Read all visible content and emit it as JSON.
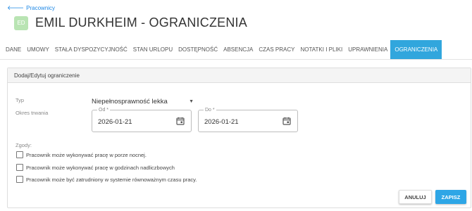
{
  "nav": {
    "back_arrow": "🡐",
    "back_label": "Pracownicy",
    "back_icon": "arrow-left-icon"
  },
  "header": {
    "avatar_initials": "ED",
    "title": "EMIL DURKHEIM - OGRANICZENIA"
  },
  "tabs": [
    {
      "label": "DANE",
      "active": false
    },
    {
      "label": "UMOWY",
      "active": false
    },
    {
      "label": "STAŁA DYSPOZYCYJNOŚĆ",
      "active": false
    },
    {
      "label": "STAN URLOPU",
      "active": false
    },
    {
      "label": "DOSTĘPNOŚĆ",
      "active": false
    },
    {
      "label": "ABSENCJA",
      "active": false
    },
    {
      "label": "CZAS PRACY",
      "active": false
    },
    {
      "label": "NOTATKI I PLIKI",
      "active": false
    },
    {
      "label": "UPRAWNIENIA",
      "active": false
    },
    {
      "label": "OGRANICZENIA",
      "active": true
    }
  ],
  "panel": {
    "title": "Dodaj/Edytuj ograniczenie",
    "type_label": "Typ",
    "type_value": "Niepełnosprawność lekka",
    "duration_label": "Okres trwania",
    "from_label": "Od *",
    "from_value": "2026-01-21",
    "to_label": "Do *",
    "to_value": "2026-01-21",
    "consents_label": "Zgody:",
    "consents": [
      "Pracownik może wykonywać pracę w porze nocnej.",
      "Pracownik może wykonywać pracę w godzinach nadliczbowych",
      "Pracownik może być zatrudniony w systemie równoważnym czasu pracy."
    ],
    "cancel_label": "ANULUJ",
    "save_label": "ZAPISZ"
  },
  "colors": {
    "accent": "#31a6dd",
    "save": "#2ea6e6",
    "avatar": "#b9e4b3",
    "link": "#1e88e5"
  }
}
